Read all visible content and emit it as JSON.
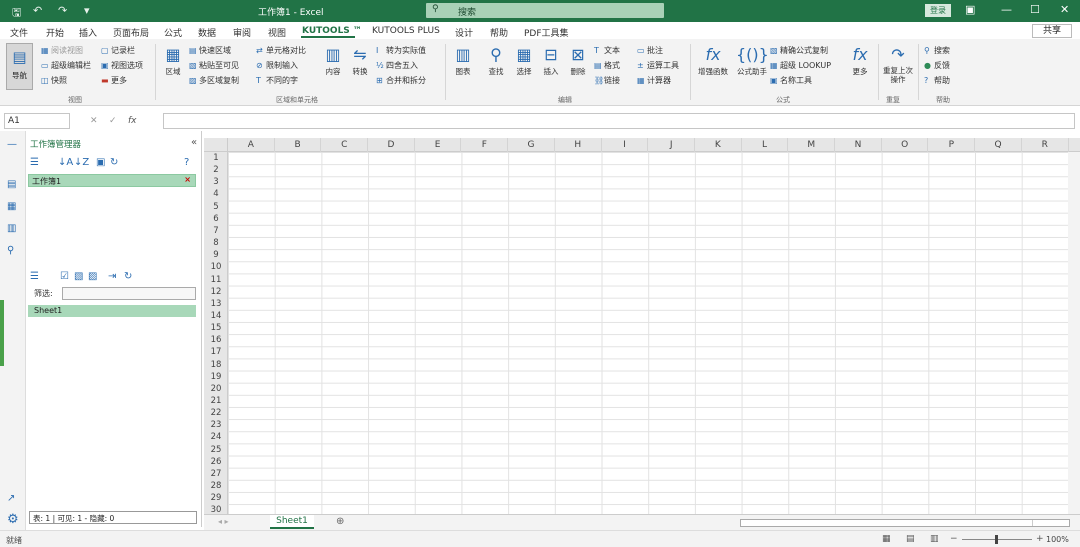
{
  "titlebar": {
    "title": "工作簿1 - Excel",
    "search_placeholder": "搜索",
    "signin": "登录"
  },
  "tabs": [
    "文件",
    "开始",
    "插入",
    "页面布局",
    "公式",
    "数据",
    "审阅",
    "视图",
    "KUTOOLS ™",
    "KUTOOLS PLUS",
    "设计",
    "帮助",
    "PDF工具集"
  ],
  "share": "共享",
  "ribbon": {
    "nav": "导航",
    "view_items": [
      "阅读视图",
      "超级编辑栏",
      "快照"
    ],
    "view_items2": [
      "记录栏",
      "视图选项",
      "更多"
    ],
    "group_view": "视图",
    "range_items": [
      "快速区域",
      "粘贴至可见",
      "多区域复制"
    ],
    "range_items2": [
      "单元格对比",
      "限制输入",
      "不同的字"
    ],
    "group_range": "区域和单元格",
    "btn_content": "内容",
    "btn_convert": "转换",
    "range_items3": [
      "转为实际值",
      "四舍五入",
      "合并和拆分"
    ],
    "edit_btns": [
      "图表",
      "查找",
      "选择",
      "插入",
      "删除"
    ],
    "edit_items": [
      "文本",
      "格式",
      "链接"
    ],
    "edit_items2": [
      "批注",
      "运算工具",
      "计算器"
    ],
    "group_edit": "编辑",
    "formula_btns": [
      "增强函数",
      "公式助手"
    ],
    "formula_items": [
      "精确公式复制",
      "超级 LOOKUP",
      "名称工具"
    ],
    "btn_more": "更多",
    "group_formula": "公式",
    "btn_rerun": "重复上次操作",
    "group_rerun": "重复",
    "help_items": [
      "搜索",
      "反馈",
      "帮助"
    ],
    "group_help": "帮助"
  },
  "formula_bar": {
    "namebox": "A1"
  },
  "pane": {
    "title": "工作簿管理器",
    "workbook": "工作簿1",
    "filter_label": "筛选:",
    "sheet": "Sheet1",
    "status": "表: 1 | 可见: 1 - 隐藏: 0"
  },
  "columns": [
    "A",
    "B",
    "C",
    "D",
    "E",
    "F",
    "G",
    "H",
    "I",
    "J",
    "K",
    "L",
    "M",
    "N",
    "O",
    "P",
    "Q",
    "R"
  ],
  "rows": [
    "1",
    "2",
    "3",
    "4",
    "5",
    "6",
    "7",
    "8",
    "9",
    "10",
    "11",
    "12",
    "13",
    "14",
    "15",
    "16",
    "17",
    "18",
    "19",
    "20",
    "21",
    "22",
    "23",
    "24",
    "25",
    "26",
    "27",
    "28",
    "29",
    "30"
  ],
  "sheet_tab": "Sheet1",
  "statusbar": {
    "ready": "就绪",
    "zoom": "100%"
  }
}
